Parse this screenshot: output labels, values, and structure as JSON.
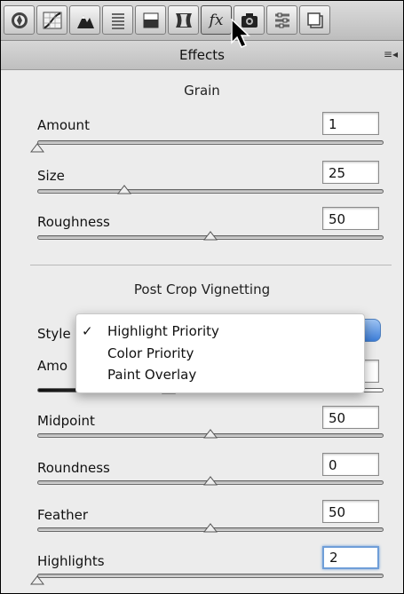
{
  "panel": {
    "title": "Effects",
    "menu_icon": "panel-menu-icon"
  },
  "toolbar": {
    "tabs": [
      {
        "icon": "basic-icon"
      },
      {
        "icon": "tone-curve-icon"
      },
      {
        "icon": "detail-icon"
      },
      {
        "icon": "hsl-icon"
      },
      {
        "icon": "split-toning-icon"
      },
      {
        "icon": "lens-corrections-icon"
      },
      {
        "icon": "effects-fx-icon",
        "label": "fx",
        "active": true
      },
      {
        "icon": "camera-calibration-icon"
      },
      {
        "icon": "presets-icon"
      },
      {
        "icon": "snapshots-icon"
      }
    ]
  },
  "grain": {
    "title": "Grain",
    "sliders": [
      {
        "label": "Amount",
        "value": "1",
        "position": 0.0
      },
      {
        "label": "Size",
        "value": "25",
        "position": 0.25
      },
      {
        "label": "Roughness",
        "value": "50",
        "position": 0.5
      }
    ]
  },
  "vignetting": {
    "title": "Post Crop Vignetting",
    "style_label": "Style",
    "amount_label": "Amo",
    "style_options": [
      {
        "label": "Highlight Priority",
        "checked": true,
        "check": "✓"
      },
      {
        "label": "Color Priority",
        "checked": false
      },
      {
        "label": "Paint Overlay",
        "checked": false
      }
    ],
    "amount_position": 0.38,
    "sliders": [
      {
        "label": "Midpoint",
        "value": "50",
        "position": 0.5
      },
      {
        "label": "Roundness",
        "value": "0",
        "position": 0.5
      },
      {
        "label": "Feather",
        "value": "50",
        "position": 0.5
      },
      {
        "label": "Highlights",
        "value": "2",
        "position": 0.0,
        "focused": true
      }
    ]
  }
}
